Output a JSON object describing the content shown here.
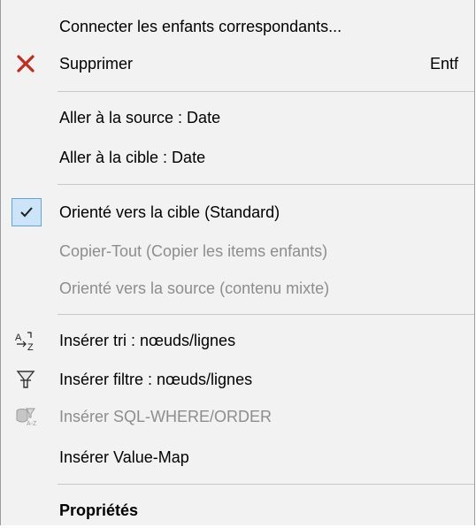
{
  "menu": {
    "items": [
      {
        "label": "Connecter les enfants correspondants...",
        "state": "enabled"
      },
      {
        "label": "Supprimer",
        "shortcut": "Entf",
        "icon": "delete-x-icon",
        "state": "enabled"
      },
      {
        "label": "Aller à la source : Date",
        "state": "enabled"
      },
      {
        "label": "Aller à la cible : Date",
        "state": "enabled"
      },
      {
        "label": "Orienté vers la cible (Standard)",
        "icon": "checkmark-icon",
        "state": "checked"
      },
      {
        "label": "Copier-Tout (Copier les items enfants)",
        "state": "disabled"
      },
      {
        "label": "Orienté vers la source (contenu mixte)",
        "state": "disabled"
      },
      {
        "label": "Insérer tri : nœuds/lignes",
        "icon": "sort-az-icon",
        "state": "enabled"
      },
      {
        "label": "Insérer filtre : nœuds/lignes",
        "icon": "filter-icon",
        "state": "enabled"
      },
      {
        "label": "Insérer SQL-WHERE/ORDER",
        "icon": "sql-where-icon",
        "state": "disabled"
      },
      {
        "label": "Insérer Value-Map",
        "state": "enabled"
      },
      {
        "label": "Propriétés",
        "state": "enabled"
      }
    ]
  },
  "colors": {
    "background": "#f2f2f2",
    "delete_icon": "#c42b1c",
    "check_highlight": "#cce4f7",
    "disabled_text": "#8d8d8d"
  }
}
